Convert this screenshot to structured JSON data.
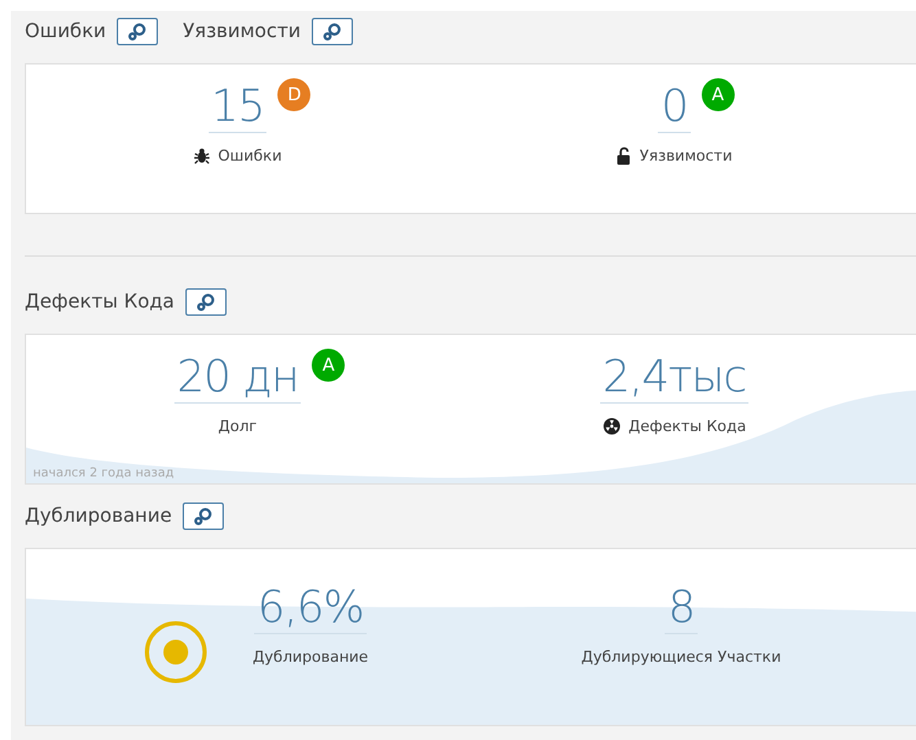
{
  "sections": [
    {
      "titles": [
        "Ошибки",
        "Уязвимости"
      ],
      "kind": "plain",
      "measures": [
        {
          "value": "15",
          "rating": {
            "letter": "D",
            "color": "#e67e22"
          },
          "kind": "bug",
          "label": "Ошибки"
        },
        {
          "value": "0",
          "rating": {
            "letter": "A",
            "color": "#00aa00"
          },
          "kind": "lock",
          "label": "Уязвимости"
        }
      ]
    },
    {
      "titles": [
        "Дефекты Кода"
      ],
      "kind": "trend",
      "note": "начался 2 года назад",
      "measures": [
        {
          "value": "20 дн",
          "rating": {
            "letter": "A",
            "color": "#00aa00"
          },
          "label": "Долг"
        },
        {
          "value": "2,4тыс",
          "kind": "radiation",
          "label": "Дефекты Кода"
        }
      ]
    },
    {
      "titles": [
        "Дублирование"
      ],
      "kind": "gauge",
      "measures": [
        {
          "value": "6,6%",
          "label": "Дублирование"
        },
        {
          "value": "8",
          "label": "Дублирующиеся Участки"
        }
      ]
    }
  ]
}
